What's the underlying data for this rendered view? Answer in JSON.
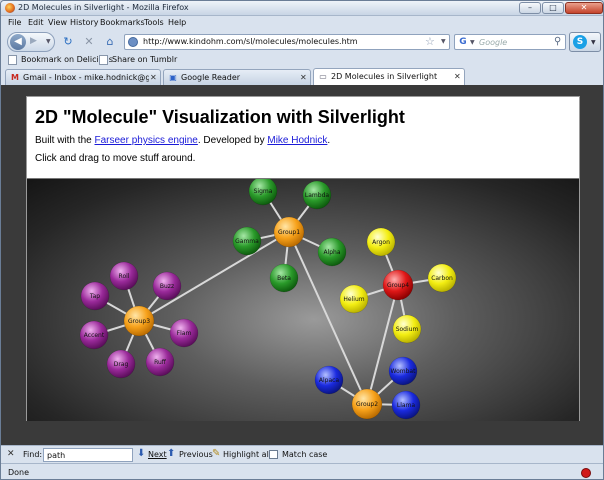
{
  "window": {
    "title": "2D Molecules in Silverlight - Mozilla Firefox",
    "controls": {
      "minimize": "–",
      "maximize": "□",
      "close": "✕"
    }
  },
  "menu": [
    "File",
    "Edit",
    "View",
    "History",
    "Bookmarks",
    "Tools",
    "Help"
  ],
  "nav": {
    "url": "http://www.kindohm.com/sl/molecules/molecules.htm",
    "search_placeholder": "Google"
  },
  "bookmarks": [
    {
      "label": "Bookmark on Delicious"
    },
    {
      "label": "Share on Tumblr"
    }
  ],
  "tabs": [
    {
      "label": "Gmail - Inbox - mike.hodnick@gma...",
      "icon": "gmail-icon",
      "active": false
    },
    {
      "label": "Google Reader",
      "icon": "google-reader-icon",
      "active": false
    },
    {
      "label": "2D Molecules in Silverlight",
      "icon": "page-icon",
      "active": true
    }
  ],
  "page": {
    "heading": "2D \"Molecule\" Visualization with Silverlight",
    "built_prefix": "Built with the ",
    "farseer_link": "Farseer physics engine",
    "developed_by": ". Developed by ",
    "author_link": "Mike Hodnick",
    "period": ".",
    "instruction": "Click and drag to move stuff around."
  },
  "molecules": {
    "colors": {
      "orange": "#f7a11a",
      "green": "#2a9a2a",
      "purple": "#9a2a9a",
      "yellow": "#f3ee12",
      "red": "#e01818",
      "blue": "#1a2adf"
    },
    "nodes": [
      {
        "label": "Group1",
        "color": "orange"
      },
      {
        "label": "Sigma",
        "color": "green"
      },
      {
        "label": "Lambda",
        "color": "green"
      },
      {
        "label": "Gamma",
        "color": "green"
      },
      {
        "label": "Alpha",
        "color": "green"
      },
      {
        "label": "Beta",
        "color": "green"
      },
      {
        "label": "Group3",
        "color": "orange"
      },
      {
        "label": "Roll",
        "color": "purple"
      },
      {
        "label": "Buzz",
        "color": "purple"
      },
      {
        "label": "Tap",
        "color": "purple"
      },
      {
        "label": "Flam",
        "color": "purple"
      },
      {
        "label": "Accent",
        "color": "purple"
      },
      {
        "label": "Drag",
        "color": "purple"
      },
      {
        "label": "Ruff",
        "color": "purple"
      },
      {
        "label": "Group4",
        "color": "red"
      },
      {
        "label": "Argon",
        "color": "yellow"
      },
      {
        "label": "Carbon",
        "color": "yellow"
      },
      {
        "label": "Helium",
        "color": "yellow"
      },
      {
        "label": "Sodium",
        "color": "yellow"
      },
      {
        "label": "Group2",
        "color": "orange"
      },
      {
        "label": "Wombat",
        "color": "blue"
      },
      {
        "label": "Alpaca",
        "color": "blue"
      },
      {
        "label": "Llama",
        "color": "blue"
      }
    ],
    "edges": [
      [
        "Group1",
        "Sigma"
      ],
      [
        "Group1",
        "Lambda"
      ],
      [
        "Group1",
        "Gamma"
      ],
      [
        "Group1",
        "Alpha"
      ],
      [
        "Group1",
        "Beta"
      ],
      [
        "Group3",
        "Roll"
      ],
      [
        "Group3",
        "Buzz"
      ],
      [
        "Group3",
        "Tap"
      ],
      [
        "Group3",
        "Flam"
      ],
      [
        "Group3",
        "Accent"
      ],
      [
        "Group3",
        "Drag"
      ],
      [
        "Group3",
        "Ruff"
      ],
      [
        "Group4",
        "Argon"
      ],
      [
        "Group4",
        "Carbon"
      ],
      [
        "Group4",
        "Helium"
      ],
      [
        "Group4",
        "Sodium"
      ],
      [
        "Group2",
        "Wombat"
      ],
      [
        "Group2",
        "Alpaca"
      ],
      [
        "Group2",
        "Llama"
      ],
      [
        "Group1",
        "Group3"
      ],
      [
        "Group1",
        "Group2"
      ],
      [
        "Group4",
        "Group2"
      ]
    ]
  },
  "find": {
    "label": "Find:",
    "value": "path",
    "next": "Next",
    "previous": "Previous",
    "highlight_all": "Highlight all",
    "match_case": "Match case"
  },
  "status": "Done"
}
